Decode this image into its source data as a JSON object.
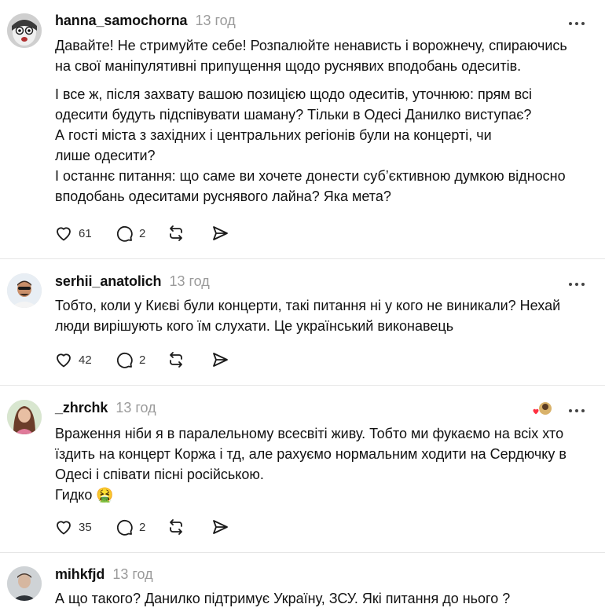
{
  "colors": {
    "text": "#111111",
    "muted": "#9a9a9a",
    "divider": "#e6e6e6",
    "icon": "#1a1a1a",
    "liked_heart": "#ff3040"
  },
  "icons": {
    "like": "heart-outline-icon",
    "reply": "speech-bubble-icon",
    "repost": "repost-arrows-icon",
    "share": "paper-plane-icon",
    "more": "three-dots-icon"
  },
  "posts": [
    {
      "username": "hanna_samochorna",
      "time": "13 год",
      "paragraphs": [
        [
          "Давайте! Не стримуйте себе! Розпалюйте ненависть і ворожнечу, спираючись",
          "на свої маніпулятивні припущення щодо руснявих вподобань одеситів."
        ],
        [
          "І все ж, після захвату вашою позицією щодо одеситів, уточнюю: прям всі",
          "одесити будуть підспівувати шаману? Тільки в Одесі Данилко виступає?",
          "А гості міста з західних і центральних регіонів були на концерті, чи",
          "лише одесити?",
          "І останнє питання: що саме ви хочете донести суб’єктивною думкою відносно",
          "вподобань одеситами руснявого лайна? Яка мета?"
        ]
      ],
      "likes": "61",
      "replies": "2"
    },
    {
      "username": "serhii_anatolich",
      "time": "13 год",
      "paragraphs": [
        [
          "Тобто, коли у Києві були концерти, такі питання ні у кого не виникали? Нехай",
          "люди вирішують кого їм слухати. Це український виконавець"
        ]
      ],
      "likes": "42",
      "replies": "2"
    },
    {
      "username": "_zhrchk",
      "time": "13 год",
      "paragraphs": [
        [
          "Враження ніби я в паралельному всесвіті живу. Тобто ми фукаємо на всіх хто",
          "їздить на концерт Коржа і тд, але рахуємо нормальним ходити на Сердючку в",
          "Одесі і співати пісні російською.",
          "Гидко 🤮"
        ]
      ],
      "likes": "35",
      "replies": "2"
    },
    {
      "username": "mihkfjd",
      "time": "13 год",
      "paragraphs": [
        [
          "А що такого? Данилко підтримує Україну, ЗСУ. Які питання до нього ?"
        ]
      ]
    }
  ]
}
